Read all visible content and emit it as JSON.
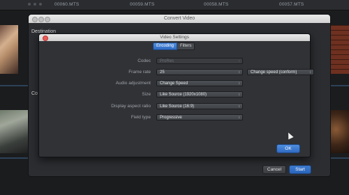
{
  "clips": [
    "00060.MTS",
    "00059.MTS",
    "00058.MTS",
    "00057.MTS"
  ],
  "convert_window": {
    "title": "Convert Video",
    "destination_label": "Destination",
    "section_label": "Co",
    "cancel_label": "Cancel",
    "start_label": "Start"
  },
  "settings": {
    "title": "Video Settings",
    "tabs": [
      "Encoding",
      "Filters"
    ],
    "active_tab": "Encoding",
    "rows": [
      {
        "label": "Codec",
        "value": "ProRes",
        "enabled": false
      },
      {
        "label": "Frame rate",
        "value": "25",
        "enabled": true
      },
      {
        "label": "Audio adjustment",
        "value": "Change Speed",
        "enabled": true
      },
      {
        "label": "Size",
        "value": "Like Source (1920x1080)",
        "enabled": true
      },
      {
        "label": "Display aspect ratio",
        "value": "Like Source (16:9)",
        "enabled": true
      },
      {
        "label": "Field type",
        "value": "Progressive",
        "enabled": true
      }
    ],
    "frame_rate_option": "Change speed (conform)",
    "ok_label": "OK"
  },
  "colors": {
    "accent": "#2f6ac2",
    "close": "#ec5a55",
    "background": "#1b1c1e"
  }
}
